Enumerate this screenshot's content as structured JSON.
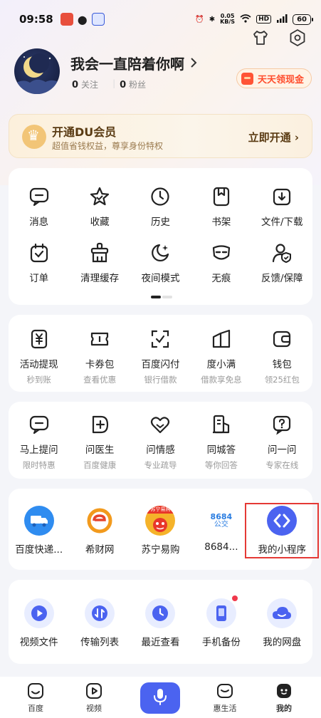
{
  "status_bar": {
    "time": "09:58",
    "net_speed_value": "0.05",
    "net_speed_unit": "KB/S",
    "hd": "HD",
    "battery": "60"
  },
  "profile": {
    "username": "我会一直陪着你啊",
    "following_count": "0",
    "following_label": "关注",
    "fans_count": "0",
    "fans_label": "粉丝",
    "cash_button": "天天领现金"
  },
  "vip": {
    "title": "开通DU会员",
    "subtitle": "超值省钱权益，尊享身份特权",
    "action": "立即开通"
  },
  "tools": [
    {
      "label": "消息",
      "icon": "message-icon"
    },
    {
      "label": "收藏",
      "icon": "star-icon"
    },
    {
      "label": "历史",
      "icon": "clock-icon"
    },
    {
      "label": "书架",
      "icon": "bookmark-icon"
    },
    {
      "label": "文件/下载",
      "icon": "download-icon"
    },
    {
      "label": "订单",
      "icon": "order-icon"
    },
    {
      "label": "清理缓存",
      "icon": "clean-icon"
    },
    {
      "label": "夜间模式",
      "icon": "moon-icon"
    },
    {
      "label": "无痕",
      "icon": "mask-icon"
    },
    {
      "label": "反馈/保障",
      "icon": "feedback-icon"
    }
  ],
  "finance": [
    {
      "label": "活动提现",
      "sub": "秒到账",
      "icon": "wallet-yen-icon"
    },
    {
      "label": "卡券包",
      "sub": "查看优惠",
      "icon": "coupon-icon"
    },
    {
      "label": "百度闪付",
      "sub": "银行借款",
      "icon": "scan-pay-icon"
    },
    {
      "label": "度小满",
      "sub": "借款享免息",
      "icon": "duxiaoman-icon"
    },
    {
      "label": "钱包",
      "sub": "领25红包",
      "icon": "wallet-icon"
    }
  ],
  "services": [
    {
      "label": "马上提问",
      "sub": "限时特惠",
      "icon": "ask-icon"
    },
    {
      "label": "问医生",
      "sub": "百度健康",
      "icon": "doctor-icon"
    },
    {
      "label": "问情感",
      "sub": "专业疏导",
      "icon": "heart-icon"
    },
    {
      "label": "同城答",
      "sub": "等你回答",
      "icon": "building-icon"
    },
    {
      "label": "问一问",
      "sub": "专家在线",
      "icon": "question-icon"
    }
  ],
  "mini_programs": [
    {
      "label": "百度快递...",
      "icon": "express-truck-icon"
    },
    {
      "label": "希财网",
      "icon": "xicai-icon"
    },
    {
      "label": "苏宁易购",
      "icon": "suning-icon",
      "logo_text": "苏宁易购"
    },
    {
      "label": "8684...",
      "icon": "bus-8684-icon",
      "logo_text_top": "8684",
      "logo_text_bottom": "公交"
    },
    {
      "label": "我的小程序",
      "icon": "mini-program-icon"
    }
  ],
  "netdisk": [
    {
      "label": "视频文件",
      "icon": "video-file-icon"
    },
    {
      "label": "传输列表",
      "icon": "transfer-icon"
    },
    {
      "label": "最近查看",
      "icon": "recent-icon"
    },
    {
      "label": "手机备份",
      "icon": "phone-backup-icon"
    },
    {
      "label": "我的网盘",
      "icon": "cloud-icon"
    }
  ],
  "bottom_nav": [
    {
      "label": "百度",
      "icon": "baidu-home-icon"
    },
    {
      "label": "视频",
      "icon": "video-icon"
    },
    {
      "label": "",
      "icon": "mic-icon"
    },
    {
      "label": "惠生活",
      "icon": "life-icon"
    },
    {
      "label": "我的",
      "icon": "mine-icon"
    }
  ],
  "colors": {
    "accent_blue": "#4b63f0",
    "highlight": "#e53935",
    "cash_red": "#ff4d2d",
    "vip_brown": "#5a3b13"
  }
}
